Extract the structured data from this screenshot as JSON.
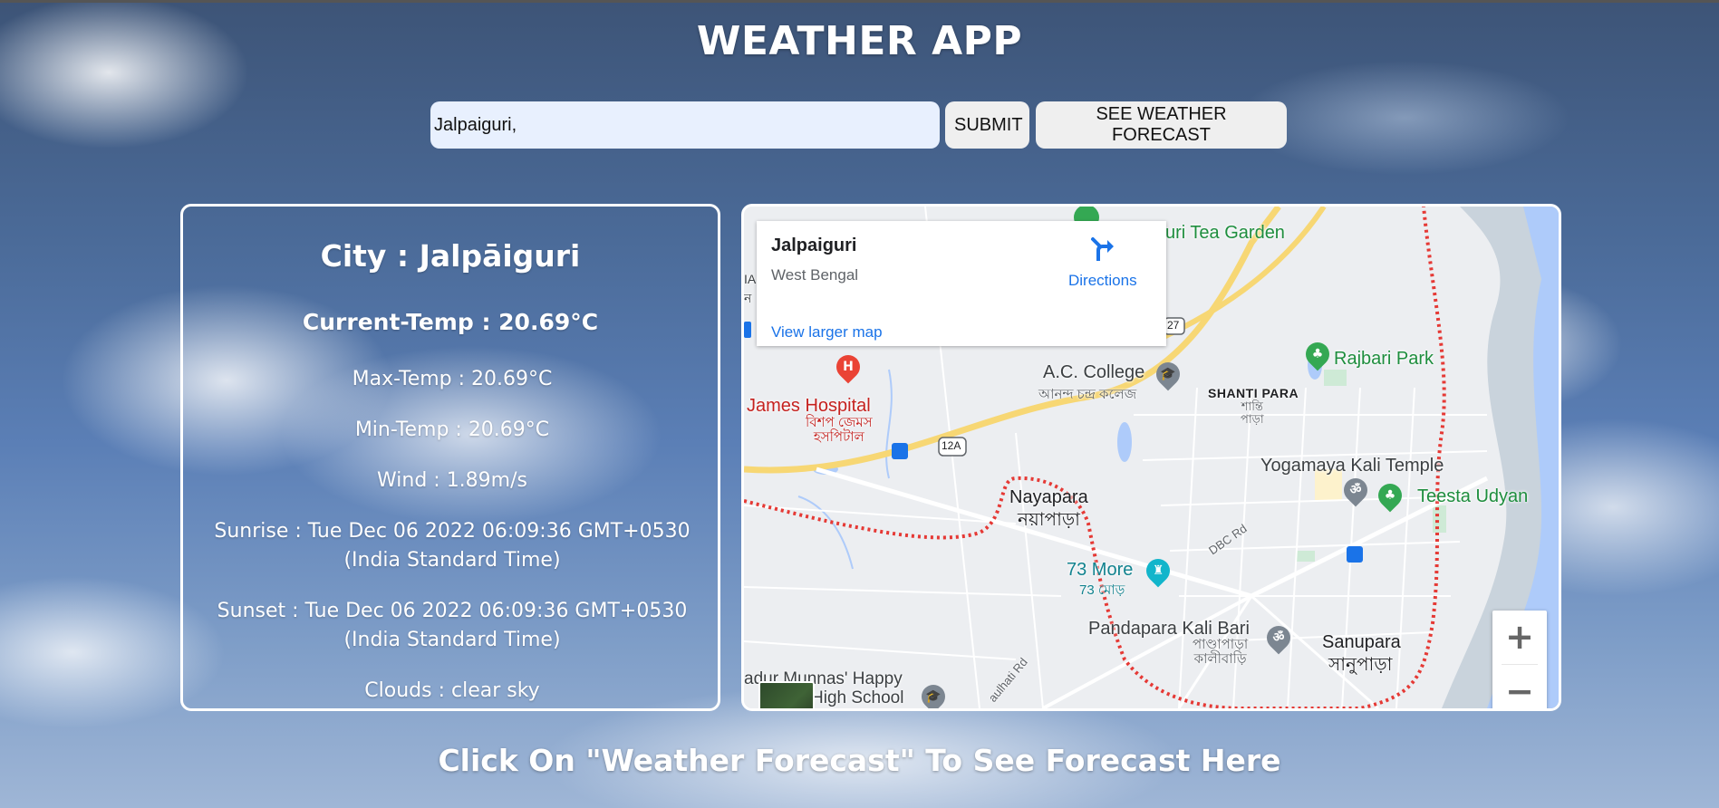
{
  "app": {
    "title": "WEATHER APP"
  },
  "search": {
    "value": "Jalpaiguri,",
    "submit_label": "SUBMIT",
    "forecast_label": "SEE WEATHER FORECAST"
  },
  "weather": {
    "city": "City : Jalpāiguri",
    "current_temp": "Current-Temp : 20.69°C",
    "max_temp": "Max-Temp : 20.69°C",
    "min_temp": "Min-Temp : 20.69°C",
    "wind": "Wind : 1.89m/s",
    "sunrise": "Sunrise : Tue Dec 06 2022 06:09:36 GMT+0530 (India Standard Time)",
    "sunset": "Sunset : Tue Dec 06 2022 06:09:36 GMT+0530 (India Standard Time)",
    "clouds": "Clouds : clear sky"
  },
  "map": {
    "info_card": {
      "title": "Jalpaiguri",
      "subtitle": "West Bengal",
      "directions_label": "Directions",
      "larger_map_label": "View larger map"
    },
    "labels": {
      "tea_garden": "uri Tea Garden",
      "ac_college": "A.C. College",
      "ac_college_bn": "আনন্দ চন্দ্র কলেজ",
      "rajbari_park": "Rajbari Park",
      "shanti_para": "SHANTI PARA",
      "shanti_para_bn": "শান্তি\nপাড়া",
      "james_hospital": "James Hospital",
      "james_hospital_bn": "বিশপ জেমস\nহসপিটাল",
      "road_12a": "12A",
      "road_27": "27",
      "yogamaya": "Yogamaya Kali Temple",
      "teesta_udyan": "Teesta Udyan",
      "nayapara": "Nayapara",
      "nayapara_bn": "নয়াপাড়া",
      "dbc_rd": "DBC Rd",
      "more_73": "73 More",
      "more_73_bn": "73 মোড়",
      "pandapara": "Pandapara Kali Bari",
      "pandapara_bn": "পাণ্ডাপাড়া\nকালীবাড়ি",
      "sanupara": "Sanupara",
      "sanupara_bn": "সানুপাড়া",
      "munnas": "adur Munnas' Happy",
      "high_school": "High School",
      "road_label": "aulhati Rd",
      "left_edge": "IA",
      "left_edge_bn": "ন"
    },
    "zoom_in": "+",
    "zoom_out": "−",
    "icons": {
      "directions": "directions-icon",
      "hospital": "hospital-icon",
      "college": "school-icon",
      "park": "park-icon",
      "temple": "temple-icon",
      "bus": "bus-icon"
    }
  },
  "footer": {
    "text": "Click On \"Weather Forecast\" To See Forecast Here"
  }
}
